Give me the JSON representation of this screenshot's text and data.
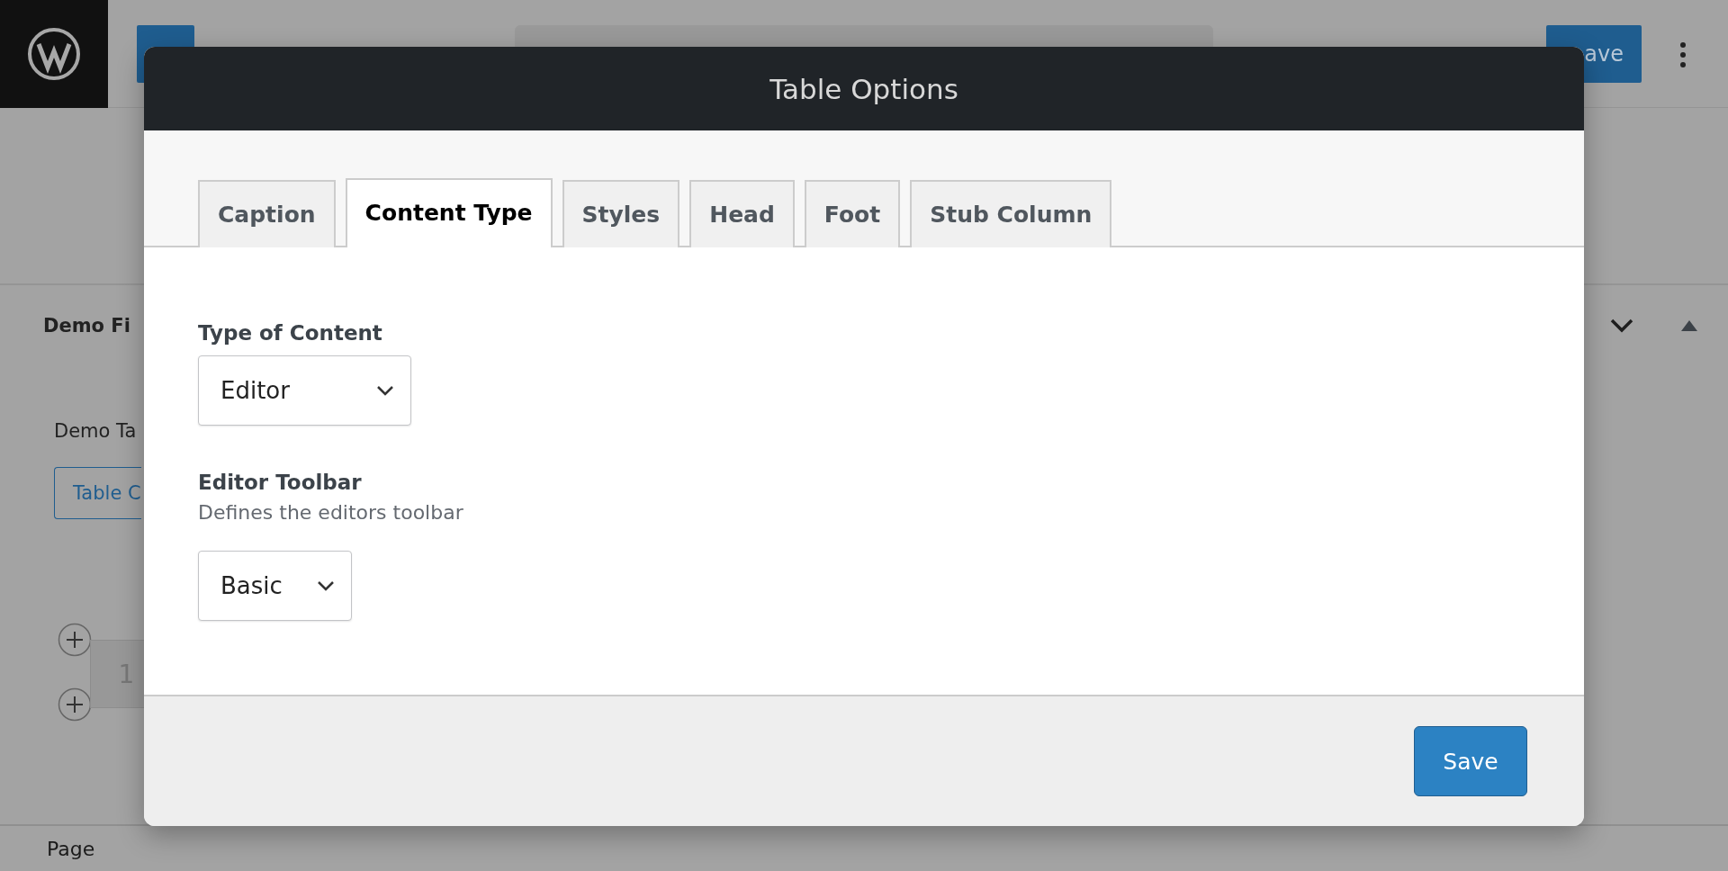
{
  "editor_background": {
    "save_button": "ave",
    "section_title": "Demo Fi",
    "field_label": "Demo Ta",
    "table_button": "Table C",
    "row_number": "1",
    "status_bar": "Page"
  },
  "dialog": {
    "title": "Table Options",
    "tabs": [
      {
        "label": "Caption",
        "selected": false
      },
      {
        "label": "Content Type",
        "selected": true
      },
      {
        "label": "Styles",
        "selected": false
      },
      {
        "label": "Head",
        "selected": false
      },
      {
        "label": "Foot",
        "selected": false
      },
      {
        "label": "Stub Column",
        "selected": false
      }
    ],
    "fields": [
      {
        "label": "Type of Content",
        "value": "Editor"
      },
      {
        "label": "Editor Toolbar",
        "help": "Defines the editors toolbar",
        "value": "Basic"
      }
    ],
    "save_button": "Save"
  }
}
